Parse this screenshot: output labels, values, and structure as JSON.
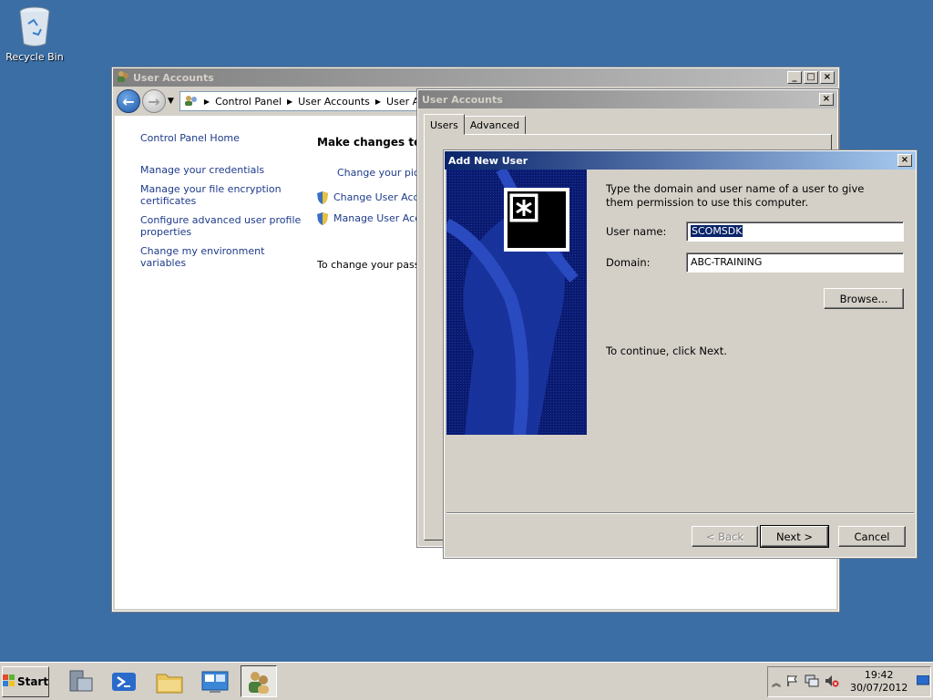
{
  "desktop": {
    "recycle_bin_label": "Recycle Bin"
  },
  "cp_window": {
    "title": "User Accounts",
    "breadcrumb": [
      "Control Panel",
      "User Accounts",
      "User Accou"
    ],
    "left_links": [
      "Control Panel Home",
      "Manage your credentials",
      "Manage your file encryption certificates",
      "Configure advanced user profile properties",
      "Change my environment variables"
    ],
    "heading": "Make changes to yo",
    "right_links": [
      "Change your pictu",
      "Change User Acco",
      "Manage User Acco"
    ],
    "password_text": "To change your passw"
  },
  "ua_dialog": {
    "title": "User Accounts",
    "tabs": [
      "Users",
      "Advanced"
    ]
  },
  "wizard": {
    "title": "Add New User",
    "instructions": "Type the domain and user name of a user to give them permission to use this computer.",
    "username_label": "User name:",
    "username_value": "SCOMSDK",
    "domain_label": "Domain:",
    "domain_value": "ABC-TRAINING",
    "browse_label": "Browse...",
    "continue_text": "To continue, click Next.",
    "back_label": "< Back",
    "next_label": "Next >",
    "cancel_label": "Cancel"
  },
  "taskbar": {
    "start_label": "Start",
    "apps": [
      "server-manager-icon",
      "powershell-icon",
      "explorer-icon",
      "control-panel-icon",
      "user-accounts-icon"
    ],
    "clock_time": "19:42",
    "clock_date": "30/07/2012"
  },
  "colors": {
    "desktop": "#3a6ea5",
    "active_title": "#0a246a",
    "link": "#1e3a8a",
    "wizard_panel": "#0a1a6e"
  }
}
